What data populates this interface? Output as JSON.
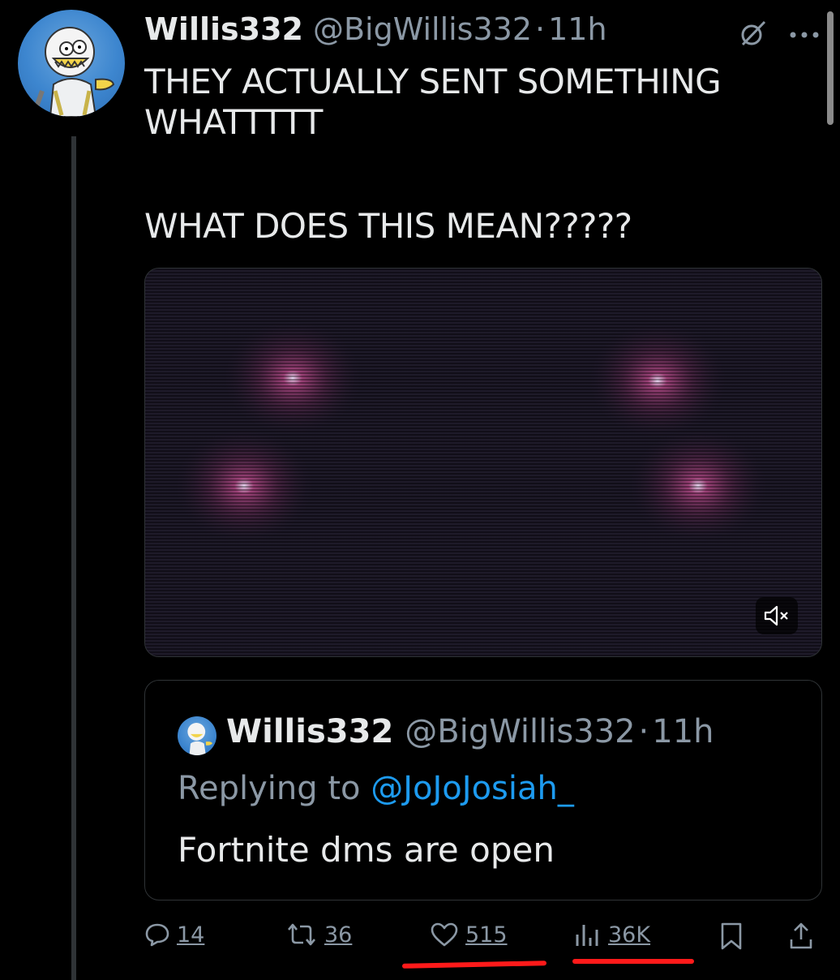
{
  "tweet": {
    "name": "Willis332",
    "handle": "@BigWillis332",
    "separator": "·",
    "time": "11h",
    "lines": [
      "THEY ACTUALLY SENT SOMETHING",
      "WHATTTTT",
      "WHAT DOES THIS MEAN?????"
    ]
  },
  "media": {
    "type": "video",
    "muted": true
  },
  "quoted": {
    "name": "Willis332",
    "handle": "@BigWillis332",
    "separator": "·",
    "time": "11h",
    "replying_prefix": "Replying to ",
    "replying_mention": "@JoJoJosiah_",
    "text": "Fortnite dms are open"
  },
  "actions": {
    "replies": "14",
    "reposts": "36",
    "likes": "515",
    "views": "36K"
  },
  "icons": {
    "reply": "reply-icon",
    "repost": "repost-icon",
    "like": "heart-icon",
    "views": "views-icon",
    "bookmark": "bookmark-icon",
    "share": "share-icon",
    "grok": "grok-icon",
    "more": "more-icon",
    "mute": "mute-icon"
  },
  "colors": {
    "background": "#000000",
    "text": "#e7e9ea",
    "secondary": "#8b98a5",
    "link": "#1d9bf0",
    "highlight": "#ff1a1a"
  }
}
